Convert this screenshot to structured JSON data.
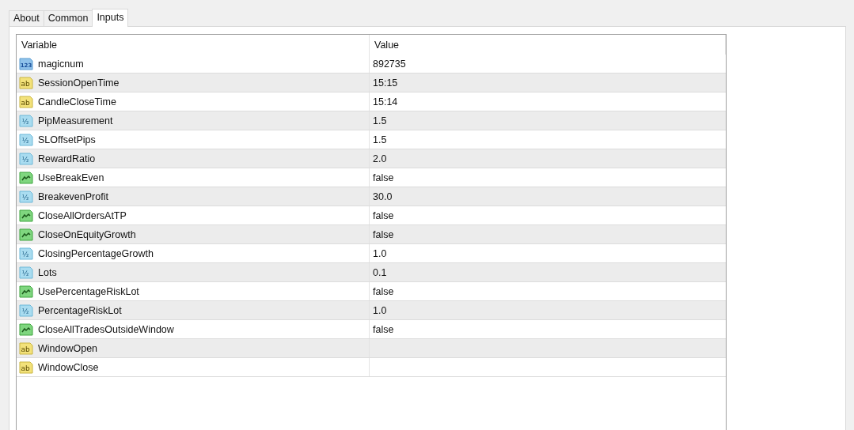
{
  "tabs": [
    {
      "label": "About",
      "selected": false
    },
    {
      "label": "Common",
      "selected": false
    },
    {
      "label": "Inputs",
      "selected": true
    }
  ],
  "table": {
    "columns": [
      "Variable",
      "Value"
    ],
    "rows": [
      {
        "kind": "int",
        "type_label": "123",
        "variable": "magicnum",
        "value": "892735"
      },
      {
        "kind": "string",
        "type_label": "ab",
        "variable": "SessionOpenTime",
        "value": "15:15"
      },
      {
        "kind": "string",
        "type_label": "ab",
        "variable": "CandleCloseTime",
        "value": "15:14"
      },
      {
        "kind": "double",
        "type_label": "½",
        "variable": "PipMeasurement",
        "value": "1.5"
      },
      {
        "kind": "double",
        "type_label": "½",
        "variable": "SLOffsetPips",
        "value": "1.5"
      },
      {
        "kind": "double",
        "type_label": "½",
        "variable": "RewardRatio",
        "value": "2.0"
      },
      {
        "kind": "bool",
        "variable": "UseBreakEven",
        "value": "false"
      },
      {
        "kind": "double",
        "type_label": "½",
        "variable": "BreakevenProfit",
        "value": "30.0"
      },
      {
        "kind": "bool",
        "variable": "CloseAllOrdersAtTP",
        "value": "false"
      },
      {
        "kind": "bool",
        "variable": "CloseOnEquityGrowth",
        "value": "false"
      },
      {
        "kind": "double",
        "type_label": "½",
        "variable": "ClosingPercentageGrowth",
        "value": "1.0"
      },
      {
        "kind": "double",
        "type_label": "½",
        "variable": "Lots",
        "value": "0.1"
      },
      {
        "kind": "bool",
        "variable": "UsePercentageRiskLot",
        "value": "false"
      },
      {
        "kind": "double",
        "type_label": "½",
        "variable": "PercentageRiskLot",
        "value": "1.0"
      },
      {
        "kind": "bool",
        "variable": "CloseAllTradesOutsideWindow",
        "value": "false"
      },
      {
        "kind": "string",
        "type_label": "ab",
        "variable": "WindowOpen"
      },
      {
        "kind": "string",
        "type_label": "ab",
        "variable": "WindowClose"
      }
    ]
  }
}
